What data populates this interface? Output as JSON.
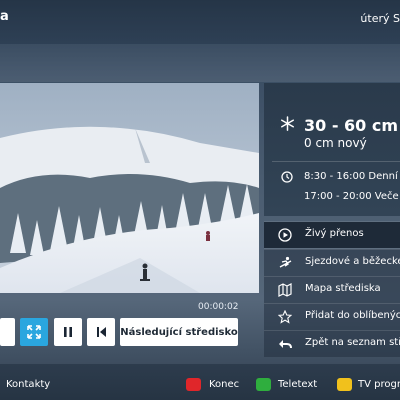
{
  "header": {
    "logo_text": "a",
    "day_text": "úterý  S"
  },
  "video": {
    "elapsed": "00:00:02"
  },
  "controls": {
    "next_resort_label": "Následující středisko"
  },
  "info": {
    "snow_depth": "30 - 60 cm",
    "new_snow": "0 cm nový",
    "hours_day": "8:30 - 16:00 Denní",
    "hours_evening": "17:00 - 20:00 Veče"
  },
  "menu": {
    "items": [
      {
        "label": "Živý přenos",
        "icon": "play-circle-icon"
      },
      {
        "label": "Sjezdové a běžecké",
        "icon": "skier-icon"
      },
      {
        "label": "Mapa střediska",
        "icon": "map-icon"
      },
      {
        "label": "Přidat do oblíbených",
        "icon": "star-icon"
      },
      {
        "label": "Zpět na seznam stř",
        "icon": "back-arrow-icon"
      }
    ]
  },
  "footer": {
    "contacts": "Kontakty",
    "end": "Konec",
    "teletext": "Teletext",
    "tv_program": "TV progr"
  },
  "colors": {
    "accent": "#2aa6df",
    "key_red": "#e0262a",
    "key_green": "#2fae3e",
    "key_yellow": "#f1c11c"
  }
}
